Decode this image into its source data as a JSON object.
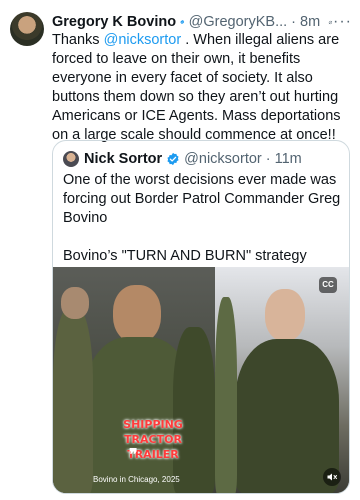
{
  "author": {
    "name": "Gregory K Bovino",
    "handle": "@GregoryKB...",
    "separator": "·",
    "time": "8m",
    "more_label": "···"
  },
  "body": {
    "prefix": "Thanks ",
    "mention": "@nicksortor",
    "suffix": " .  When illegal aliens are forced to leave on their own, it benefits everyone in every facet of society.  It also buttons them down so they aren’t out hurting Americans or ICE Agents.  Mass deportations on a large scale should commence at once!!"
  },
  "quote": {
    "name": "Nick Sortor",
    "handle": "@nicksortor",
    "separator": "·",
    "time": "11m",
    "line1": "One of the worst decisions ever made was forcing out Border Patrol Commander Greg Bovino",
    "line2": "Bovino’s \"TURN AND BURN\" strategy scared...",
    "media": {
      "overlay_text_1": "SHIPPING",
      "overlay_text_2": "TRACTOR TRAILER",
      "quote_glyph": "❞",
      "caption": "Bovino in Chicago, 2025",
      "cc_label": "CC"
    }
  },
  "icons": {
    "verified": "verified-badge-icon",
    "grok": "grok-icon",
    "more": "more-icon",
    "cc": "captions-icon",
    "mute": "mute-icon"
  },
  "colors": {
    "accent": "#1d9bf0",
    "muted": "#536471",
    "text": "#0f1419",
    "border": "#cfd9de"
  }
}
